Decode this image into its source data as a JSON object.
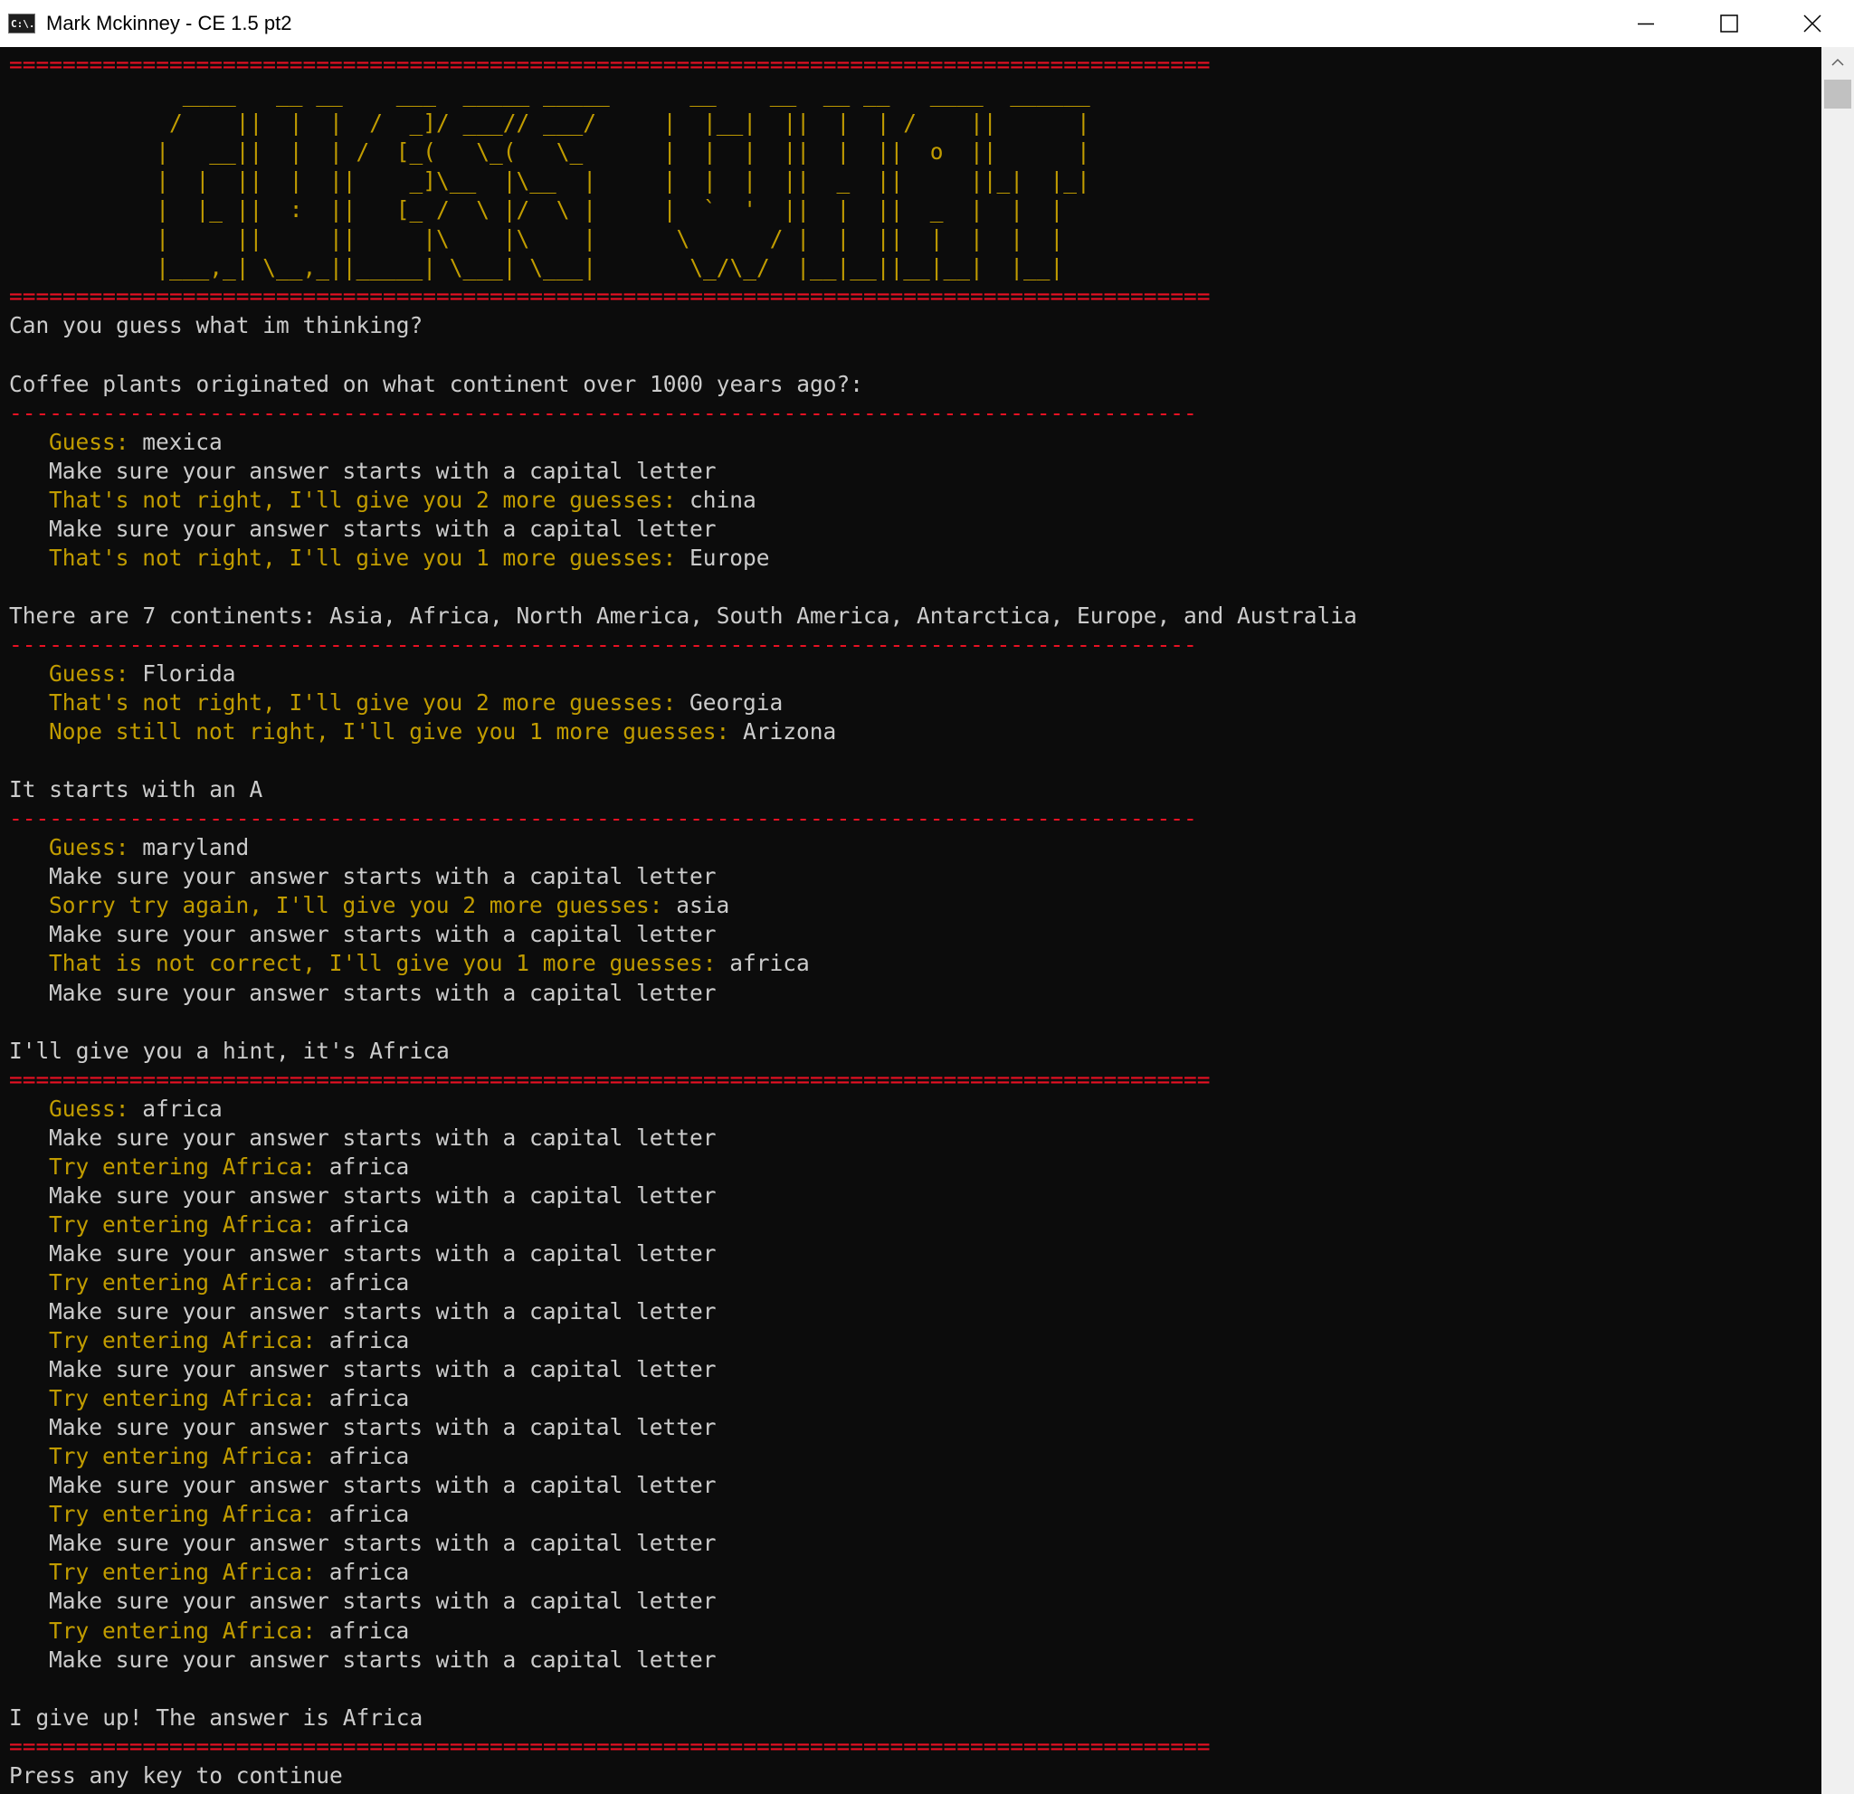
{
  "window": {
    "title": "Mark Mckinney - CE 1.5 pt2",
    "icon_label": "C:\\.",
    "colors": {
      "text": "#cccccc",
      "prompt": "#c19c00",
      "divider": "#e81123",
      "background": "#0c0c0c"
    }
  },
  "console": {
    "banner": {
      "top_rule": "==========================================================================================",
      "art": [
        "             ____   __ __    ___  _____ _____      __    __  __ __   ____  ______",
        "            /    ||  |  |  /  _]/ ___// ___/     |  |__|  ||  |  | /    ||      |",
        "           |   __||  |  | /  [_(   \\_(   \\_      |  |  |  ||  |  ||  o  ||      |",
        "           |  |  ||  |  ||    _]\\__  |\\__  |     |  |  |  ||  _  ||     ||_|  |_|",
        "           |  |_ ||  :  ||   [_ /  \\ |/  \\ |     |  `  '  ||  |  ||  _  |  |  |",
        "           |     ||     ||     |\\    |\\    |      \\      / |  |  ||  |  |  |  |",
        "           |___,_| \\__,_||_____| \\___| \\___|       \\_/\\_/  |__|__||__|__|  |__|"
      ],
      "bottom_rule": "=========================================================================================="
    },
    "intro": "Can you guess what im thinking?",
    "question": "Coffee plants originated on what continent over 1000 years ago?:",
    "dash_rule": "-----------------------------------------------------------------------------------------",
    "eq_rule": "==========================================================================================",
    "capital_msg": "Make sure your answer starts with a capital letter",
    "round1": [
      {
        "prompt": "Guess: ",
        "answer": "mexica"
      },
      {
        "prompt": "That's not right, I'll give you 2 more guesses: ",
        "answer": "china"
      },
      {
        "prompt": "That's not right, I'll give you 1 more guesses: ",
        "answer": "Europe"
      }
    ],
    "hint1": "There are 7 continents: Asia, Africa, North America, South America, Antarctica, Europe, and Australia",
    "round2": [
      {
        "prompt": "Guess: ",
        "answer": "Florida"
      },
      {
        "prompt": "That's not right, I'll give you 2 more guesses: ",
        "answer": "Georgia"
      },
      {
        "prompt": "Nope still not right, I'll give you 1 more guesses: ",
        "answer": "Arizona"
      }
    ],
    "hint2": "It starts with an A",
    "round3": [
      {
        "prompt": "Guess: ",
        "answer": "maryland"
      },
      {
        "prompt": "Sorry try again, I'll give you 2 more guesses: ",
        "answer": "asia"
      },
      {
        "prompt": "That is not correct, I'll give you 1 more guesses: ",
        "answer": "africa"
      }
    ],
    "hint3": "I'll give you a hint, it's Africa",
    "round4_first": {
      "prompt": "Guess: ",
      "answer": "africa"
    },
    "retry": {
      "prompt": "Try entering Africa: ",
      "answer": "africa"
    },
    "giveup": "I give up! The answer is Africa",
    "continue": "Press any key to continue"
  }
}
